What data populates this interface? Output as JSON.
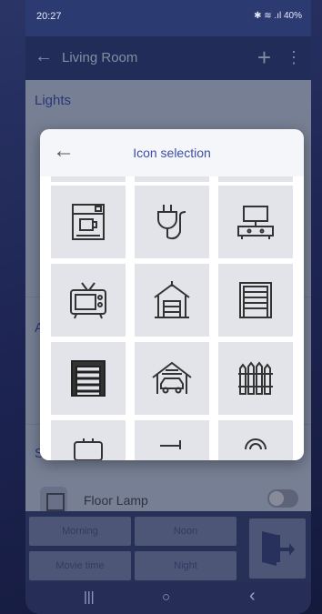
{
  "status": {
    "time": "20:27",
    "indicators": "✱ ≋ .ıl 40%"
  },
  "appbar": {
    "title": "Living Room"
  },
  "sections": {
    "lights": "Lights",
    "second": "A",
    "third": "S"
  },
  "floor_lamp": {
    "label": "Floor Lamp",
    "on": false
  },
  "scenes": {
    "morning": "Morning",
    "noon": "Noon",
    "movie": "Movie time",
    "night": "Night"
  },
  "dialog": {
    "title": "Icon selection",
    "icons": [
      {
        "name": "coffee-machine-icon"
      },
      {
        "name": "plug-icon"
      },
      {
        "name": "tv-stand-icon"
      },
      {
        "name": "retro-tv-icon"
      },
      {
        "name": "house-garage-icon"
      },
      {
        "name": "garage-door-icon"
      },
      {
        "name": "garage-closed-icon"
      },
      {
        "name": "carport-icon"
      },
      {
        "name": "fence-icon"
      },
      {
        "name": "partial-icon-1"
      },
      {
        "name": "partial-icon-2"
      },
      {
        "name": "partial-icon-3"
      }
    ]
  },
  "navbar": {
    "recent": "|||",
    "home": "○",
    "back": "‹"
  }
}
